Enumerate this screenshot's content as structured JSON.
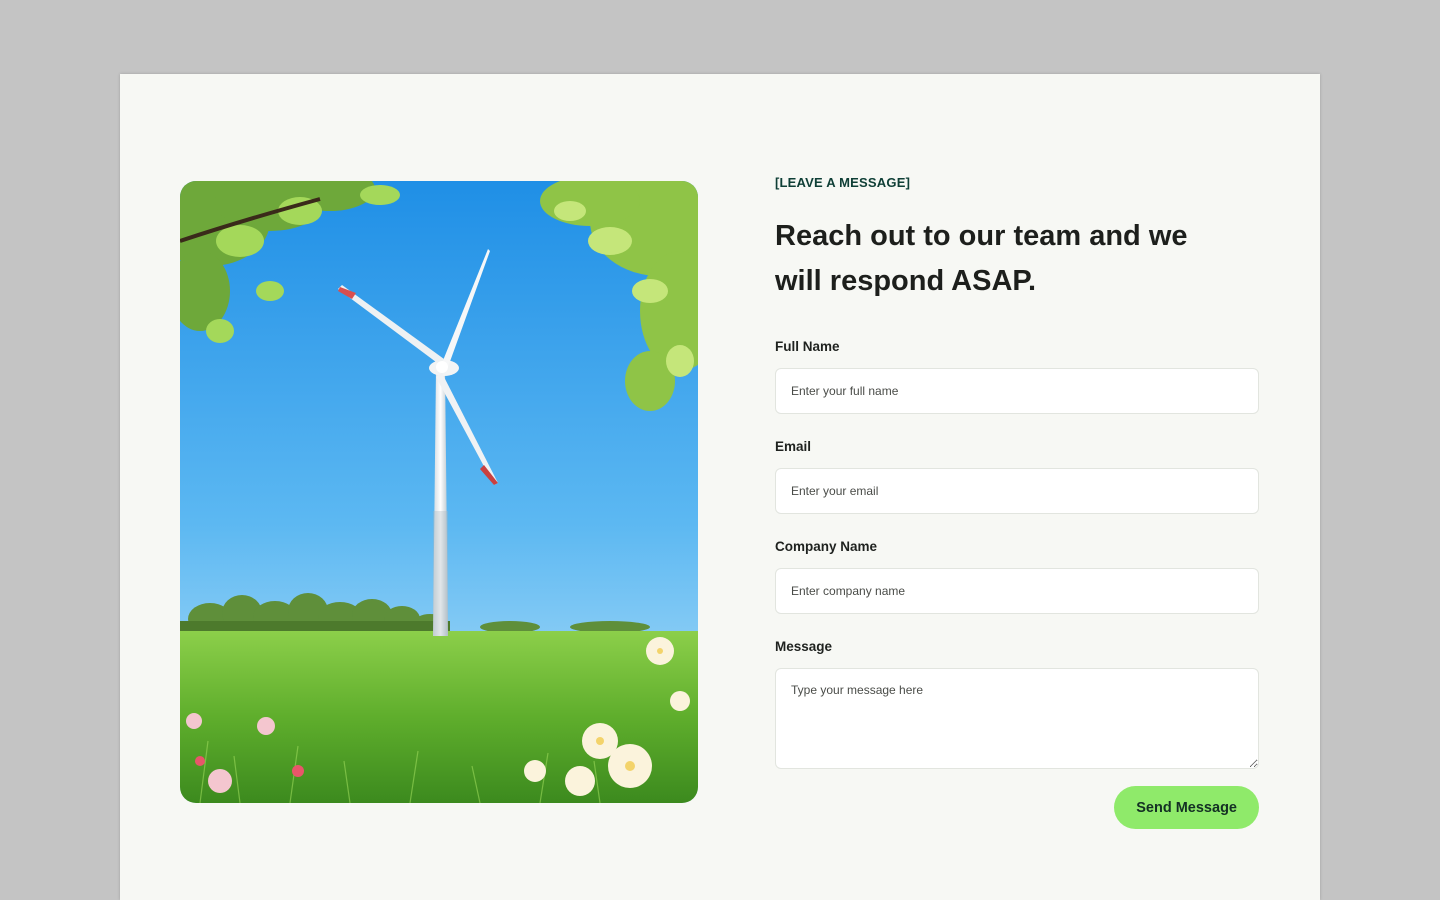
{
  "colors": {
    "page_background": "#f7f8f4",
    "accent": "#8fea6a",
    "eyebrow": "#0f3f36",
    "heading": "#1d1f1c"
  },
  "hero_image": {
    "subject": "wind-turbine-in-green-field"
  },
  "contact": {
    "eyebrow": "[LEAVE A MESSAGE]",
    "headline": "Reach out to our team and we will respond ASAP.",
    "fields": {
      "full_name": {
        "label": "Full Name",
        "placeholder": "Enter your full name"
      },
      "email": {
        "label": "Email",
        "placeholder": "Enter your email"
      },
      "company": {
        "label": "Company Name",
        "placeholder": "Enter company name"
      },
      "message": {
        "label": "Message",
        "placeholder": "Type your message here"
      }
    },
    "submit_label": "Send Message"
  }
}
